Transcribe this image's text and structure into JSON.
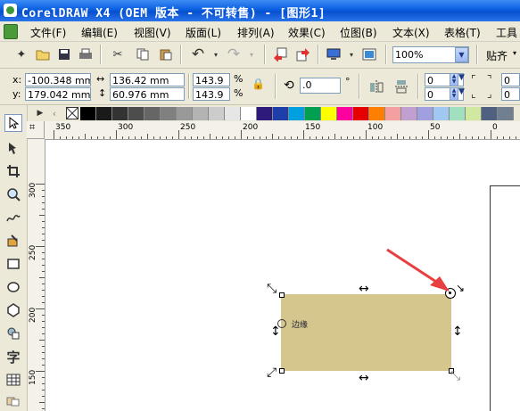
{
  "app": {
    "title": "CorelDRAW X4 (OEM 版本 - 不可转售) - [图形1]"
  },
  "menu": {
    "items": [
      "文件(F)",
      "编辑(E)",
      "视图(V)",
      "版面(L)",
      "排列(A)",
      "效果(C)",
      "位图(B)",
      "文本(X)",
      "表格(T)",
      "工具"
    ]
  },
  "toolbar": {
    "zoom_value": "100%",
    "snap_label": "贴齐"
  },
  "property_bar": {
    "x_label": "x:",
    "x_value": "-100.348 mm",
    "y_label": "y:",
    "y_value": "179.042 mm",
    "width_value": "136.42 mm",
    "height_value": "60.976 mm",
    "scale_x": "143.9",
    "scale_y": "143.9",
    "percent": "%",
    "rotation_value": ".0",
    "degree": "°",
    "corner_top": "0",
    "corner_bottom": "0",
    "corner_right_top": "0",
    "corner_right_bottom": "0"
  },
  "palette": {
    "colors": [
      "#000000",
      "#1a1a1a",
      "#333333",
      "#4d4d4d",
      "#666666",
      "#808080",
      "#999999",
      "#b3b3b3",
      "#cccccc",
      "#e6e6e6",
      "#ffffff",
      "#2e1a7a",
      "#1f3fa8",
      "#00a0e0",
      "#00a050",
      "#ffff00",
      "#ff00a0",
      "#e60000",
      "#ff8000",
      "#f5a0a0",
      "#c0a0d0",
      "#a0a0e0",
      "#a0c8f0",
      "#a0e0c0",
      "#d0e8a0",
      "#506080",
      "#708090"
    ]
  },
  "rulers": {
    "h_labels": [
      "350",
      "300",
      "250",
      "200",
      "150",
      "100",
      "50",
      "0"
    ],
    "v_labels": [
      "300",
      "250",
      "200",
      "150"
    ]
  },
  "canvas": {
    "object_label": "边缘",
    "object_color": "#d4c68c",
    "annotation_arrow_color": "#e84040"
  }
}
